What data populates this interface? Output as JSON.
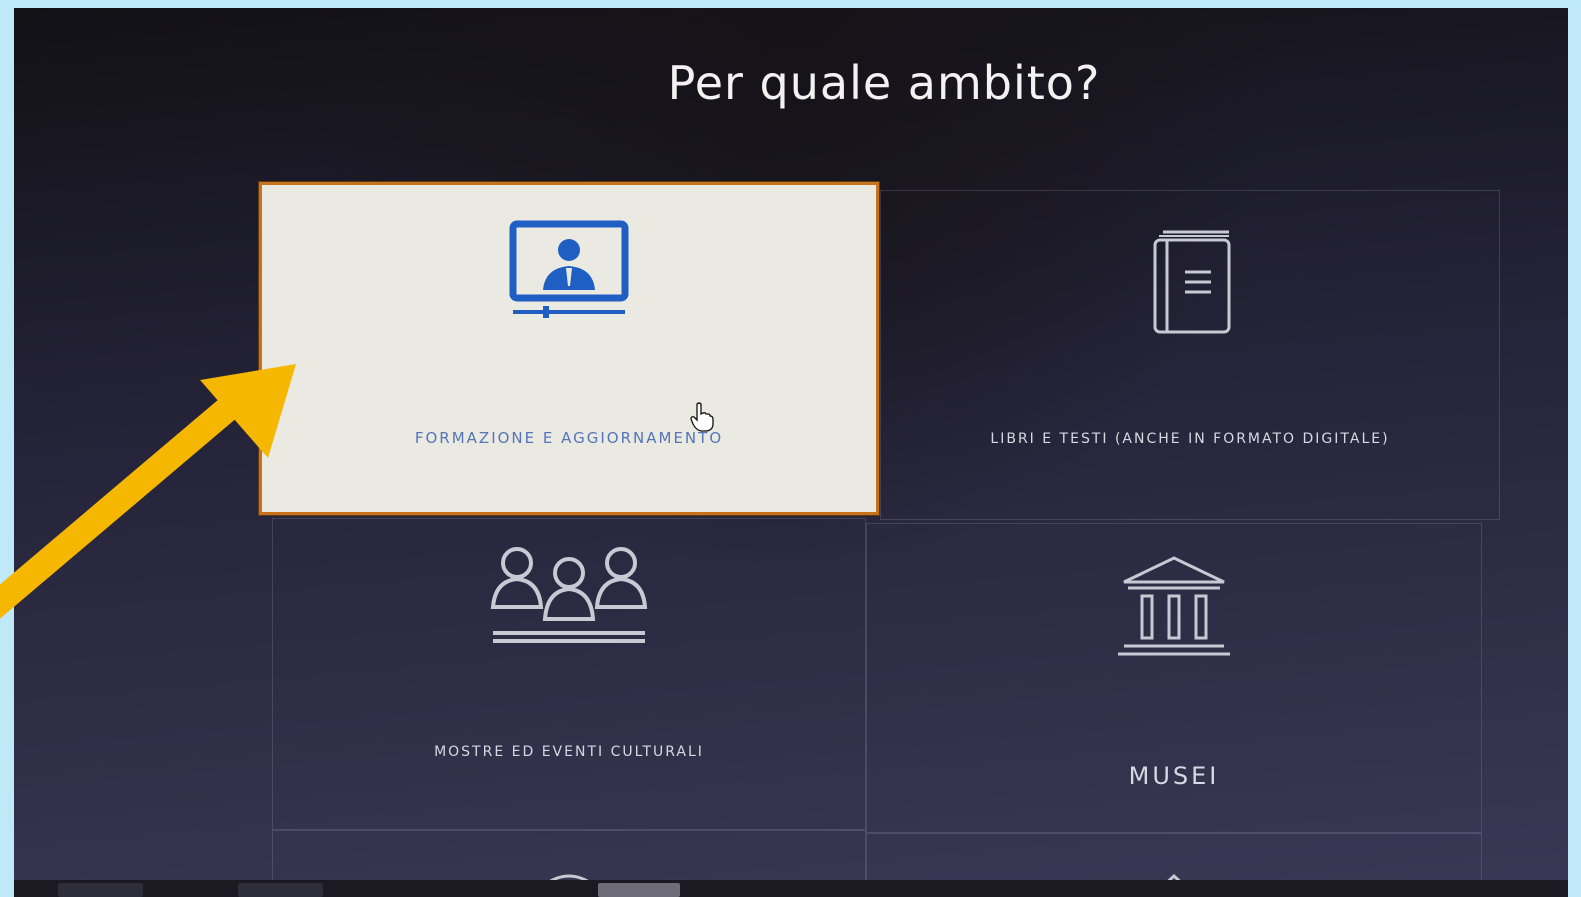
{
  "page": {
    "title": "Per quale ambito?"
  },
  "options": [
    {
      "label": "FORMAZIONE E AGGIORNAMENTO",
      "icon": "video-lesson-icon",
      "selected": true
    },
    {
      "label": "LIBRI E TESTI (ANCHE IN FORMATO DIGITALE)",
      "icon": "book-icon",
      "selected": false
    },
    {
      "label": "MOSTRE ED EVENTI CULTURALI",
      "icon": "people-group-icon",
      "selected": false
    },
    {
      "label": "MUSEI",
      "icon": "museum-icon",
      "selected": false
    }
  ],
  "colors": {
    "selected_background": "#ebeae2",
    "selected_border": "#c9721c",
    "selected_icon": "#1f5fc4",
    "annotation_arrow": "#f6b700",
    "frame": "#bfe9f7"
  }
}
